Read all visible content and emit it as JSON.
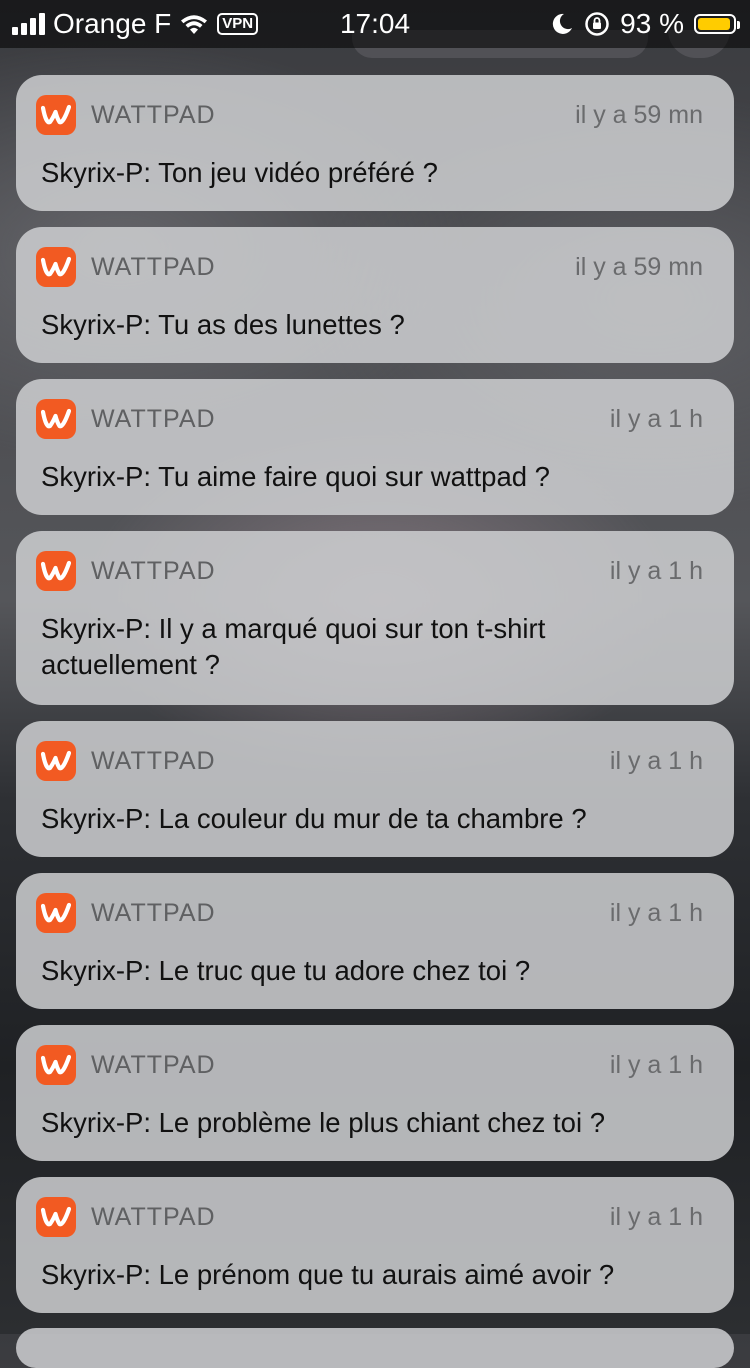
{
  "status_bar": {
    "carrier": "Orange F",
    "vpn": "VPN",
    "time": "17:04",
    "battery_percent": "93 %",
    "battery_level": 0.93,
    "battery_color": "#ffcc00"
  },
  "notifications": [
    {
      "app": "WATTPAD",
      "time": "il y a 59 mn",
      "message": "Skyrix-P: Ton jeu vidéo préféré ?"
    },
    {
      "app": "WATTPAD",
      "time": "il y a 59 mn",
      "message": "Skyrix-P: Tu as des lunettes ?"
    },
    {
      "app": "WATTPAD",
      "time": "il y a 1 h",
      "message": "Skyrix-P: Tu aime faire quoi sur wattpad ?"
    },
    {
      "app": "WATTPAD",
      "time": "il y a 1 h",
      "message": "Skyrix-P: Il y a marqué quoi sur ton t-shirt actuellement ?"
    },
    {
      "app": "WATTPAD",
      "time": "il y a 1 h",
      "message": "Skyrix-P: La couleur du mur de ta chambre ?"
    },
    {
      "app": "WATTPAD",
      "time": "il y a 1 h",
      "message": "Skyrix-P: Le truc que tu adore chez toi ?"
    },
    {
      "app": "WATTPAD",
      "time": "il y a 1 h",
      "message": "Skyrix-P: Le problème le plus chiant chez toi ?"
    },
    {
      "app": "WATTPAD",
      "time": "il y a 1 h",
      "message": "Skyrix-P: Le prénom que tu aurais aimé avoir ?"
    }
  ],
  "app_icon": {
    "name": "wattpad-logo-icon",
    "color": "#f25a22"
  }
}
